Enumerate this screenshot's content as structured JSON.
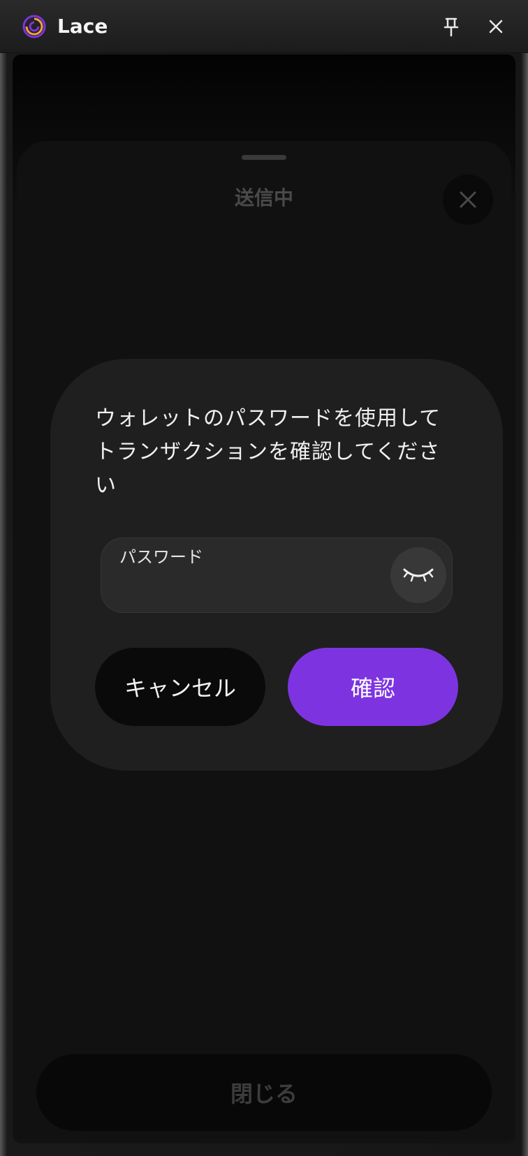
{
  "window": {
    "title": "Lace",
    "icons": {
      "logo": "lace-logo-icon",
      "pin": "pin-icon",
      "close": "close-icon"
    }
  },
  "sheet": {
    "title": "送信中",
    "close_icon": "close-icon",
    "footer_button": "閉じる"
  },
  "dialog": {
    "message": "ウォレットのパスワードを使用してトランザクションを確認してください",
    "password": {
      "label": "パスワード",
      "value": "",
      "toggle_icon": "eye-closed-icon"
    },
    "cancel_label": "キャンセル",
    "confirm_label": "確認"
  },
  "colors": {
    "accent": "#7d34e0",
    "dialog_bg": "#1f1f1f",
    "cancel_bg": "#0a0a0a"
  }
}
